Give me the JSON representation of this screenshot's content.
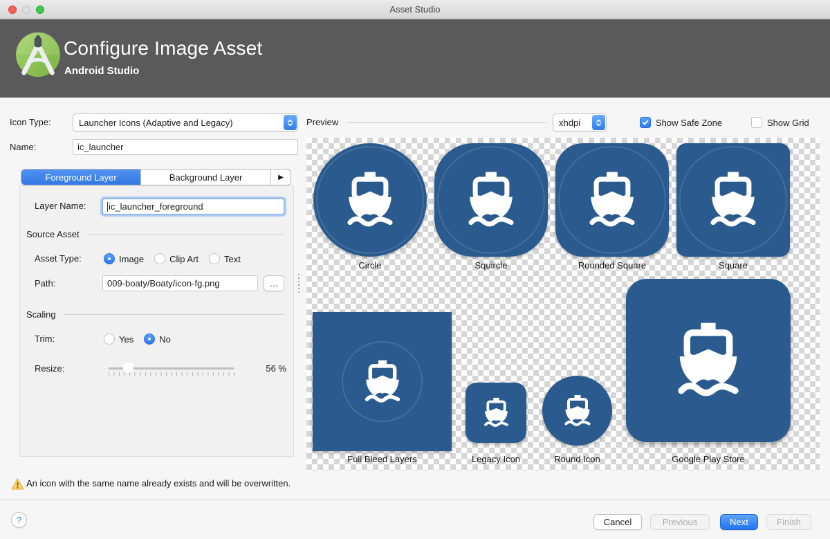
{
  "window": {
    "title": "Asset Studio"
  },
  "header": {
    "title": "Configure Image Asset",
    "subtitle": "Android Studio"
  },
  "form": {
    "icon_type_label": "Icon Type:",
    "icon_type_value": "Launcher Icons (Adaptive and Legacy)",
    "name_label": "Name:",
    "name_value": "ic_launcher",
    "tabs": [
      {
        "label": "Foreground Layer",
        "selected": true
      },
      {
        "label": "Background Layer",
        "selected": false
      }
    ],
    "layer_name_label": "Layer Name:",
    "layer_name_value": "ic_launcher_foreground",
    "source_asset_section": "Source Asset",
    "asset_type_label": "Asset Type:",
    "asset_type_options": [
      {
        "label": "Image",
        "selected": true
      },
      {
        "label": "Clip Art",
        "selected": false
      },
      {
        "label": "Text",
        "selected": false
      }
    ],
    "path_label": "Path:",
    "path_value": "009-boaty/Boaty/icon-fg.png",
    "browse_label": "…",
    "scaling_section": "Scaling",
    "trim_label": "Trim:",
    "trim_options": [
      {
        "label": "Yes",
        "selected": false
      },
      {
        "label": "No",
        "selected": true
      }
    ],
    "resize_label": "Resize:",
    "resize_value": "56 %",
    "resize_percent": 56
  },
  "preview": {
    "label": "Preview",
    "density_value": "xhdpi",
    "show_safe_zone": {
      "label": "Show Safe Zone",
      "checked": true
    },
    "show_grid": {
      "label": "Show Grid",
      "checked": false
    },
    "tiles": [
      {
        "label": "Circle",
        "shape": "circle"
      },
      {
        "label": "Squircle",
        "shape": "squircle"
      },
      {
        "label": "Rounded Square",
        "shape": "rounded-square"
      },
      {
        "label": "Square",
        "shape": "square"
      },
      {
        "label": "Full Bleed Layers",
        "shape": "full-bleed-square"
      },
      {
        "label": "Legacy Icon",
        "shape": "legacy-rounded-square"
      },
      {
        "label": "Round Icon",
        "shape": "round"
      },
      {
        "label": "Google Play Store",
        "shape": "play-rounded-square"
      }
    ]
  },
  "warning": {
    "text": "An icon with the same name already exists and will be overwritten."
  },
  "footer": {
    "help_label": "?",
    "buttons": [
      {
        "label": "Cancel",
        "style": "normal"
      },
      {
        "label": "Previous",
        "style": "disabled"
      },
      {
        "label": "Next",
        "style": "primary"
      },
      {
        "label": "Finish",
        "style": "disabled"
      }
    ]
  },
  "colors": {
    "icon_blue": "#2A5A8E",
    "accent_blue": "#3B7FF2",
    "header_gray": "#5A5A5A",
    "warning_yellow": "#FBD56B"
  }
}
